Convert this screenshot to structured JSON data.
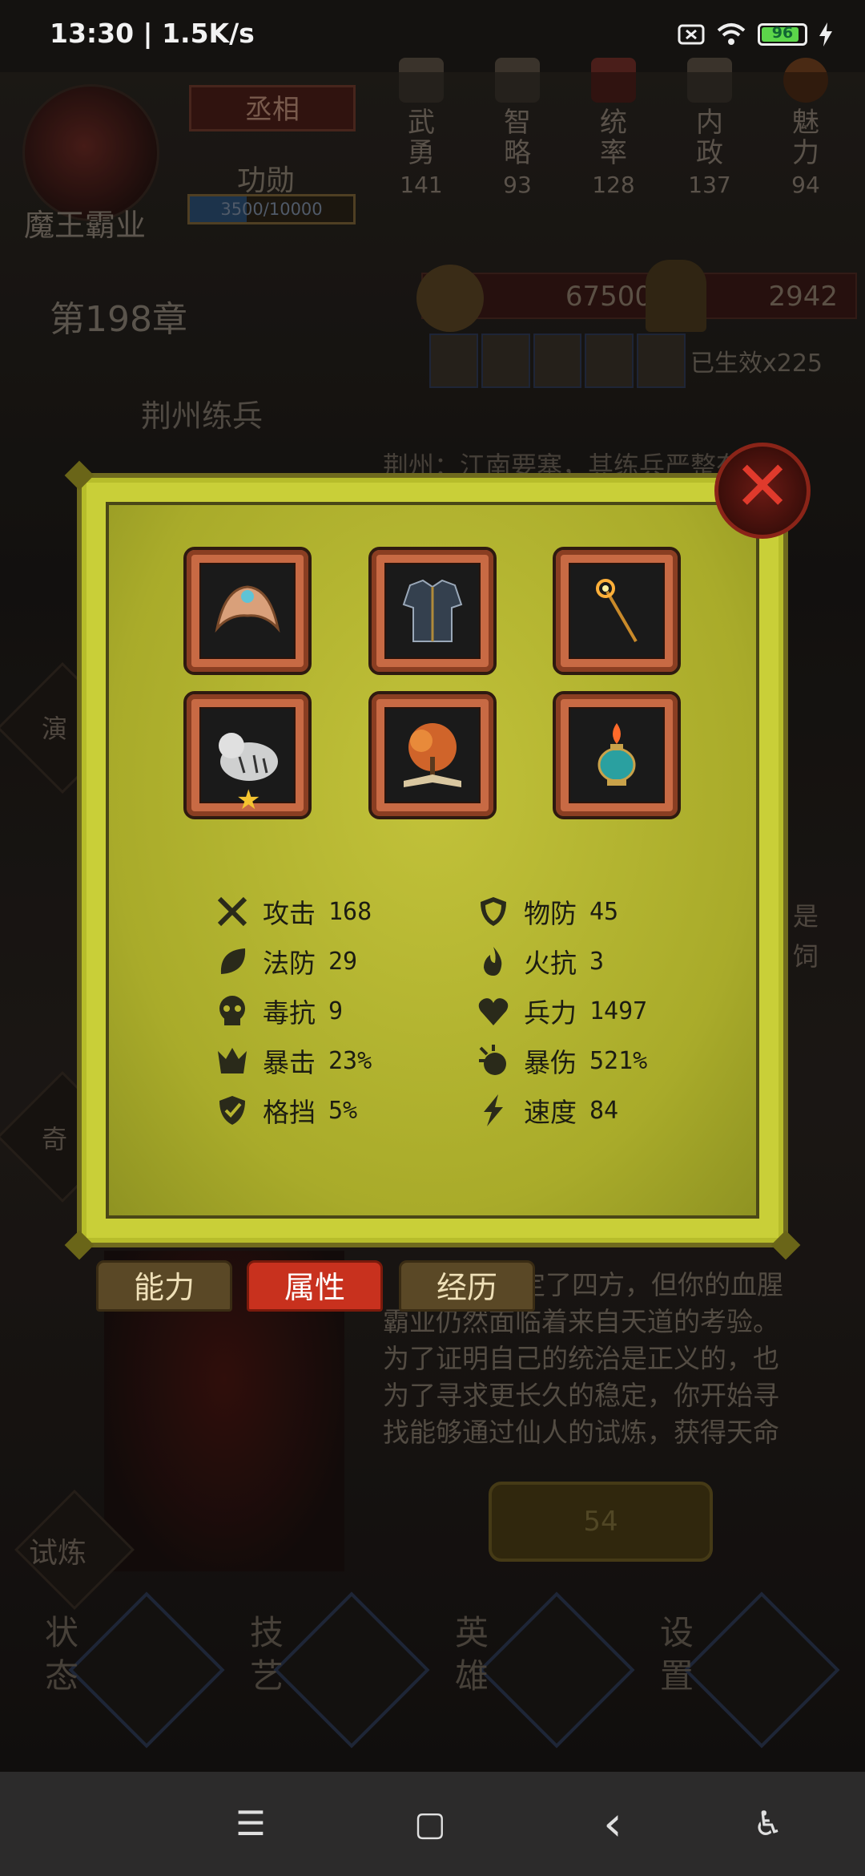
{
  "status_bar": {
    "time_speed": "13:30 | 1.5K/s",
    "battery": "96"
  },
  "header": {
    "title_badge": "丞相",
    "gongxun_label": "功勋",
    "exp_text": "3500/10000",
    "exp_progress": 0.35,
    "hero_name": "魔王霸业",
    "stats": [
      {
        "name": "武勇",
        "value": "141"
      },
      {
        "name": "智略",
        "value": "93"
      },
      {
        "name": "统率",
        "value": "128"
      },
      {
        "name": "内政",
        "value": "137"
      },
      {
        "name": "魅力",
        "value": "94"
      }
    ],
    "chapter": "第198章",
    "coins": "67500",
    "grain": "2942",
    "buildings_effect": "已生效x225",
    "mission": "荆州练兵"
  },
  "story": {
    "top_line": "荆州：江南要塞，其练兵严整有序。",
    "lower_lines": [
      "定了四方，但你的血腥",
      "霸业仍然面临着来自天道的考验。",
      "为了证明自己的统治是正义的，也",
      "为了寻求更长久的稳定，你开始寻",
      "找能够通过仙人的试炼，获得天命"
    ]
  },
  "side": {
    "left_top": "演",
    "left_mid": "奇",
    "trial": "试炼",
    "right_chars": [
      "是",
      "饲"
    ]
  },
  "action_button": {
    "value": "54"
  },
  "bottom_menu": [
    {
      "label_1": "状",
      "label_2": "态"
    },
    {
      "label_1": "技",
      "label_2": "艺"
    },
    {
      "label_1": "英",
      "label_2": "雄"
    },
    {
      "label_1": "设",
      "label_2": "置"
    }
  ],
  "modal": {
    "close_symbol": "✕",
    "equipment": [
      {
        "name": "crown-icon",
        "color": "#e0a070"
      },
      {
        "name": "armor-icon",
        "color": "#3c4a5c"
      },
      {
        "name": "staff-icon",
        "color": "#d08a2a"
      },
      {
        "name": "tiger-icon",
        "color": "#c8c8c8",
        "star": "★"
      },
      {
        "name": "tree-book-icon",
        "color": "#d0642a"
      },
      {
        "name": "lamp-icon",
        "color": "#2aa0a0"
      }
    ],
    "attributes_left": [
      {
        "icon": "sword-icon",
        "name": "攻击",
        "value": "168"
      },
      {
        "icon": "leaf-icon",
        "name": "法防",
        "value": "29"
      },
      {
        "icon": "skull-icon",
        "name": "毒抗",
        "value": "9"
      },
      {
        "icon": "crown-burst-icon",
        "name": "暴击",
        "value": "23%"
      },
      {
        "icon": "shield-check-icon",
        "name": "格挡",
        "value": "5%"
      }
    ],
    "attributes_right": [
      {
        "icon": "shield-icon",
        "name": "物防",
        "value": "45"
      },
      {
        "icon": "fire-icon",
        "name": "火抗",
        "value": "3"
      },
      {
        "icon": "heart-icon",
        "name": "兵力",
        "value": "1497"
      },
      {
        "icon": "explosion-icon",
        "name": "暴伤",
        "value": "521%"
      },
      {
        "icon": "lightning-icon",
        "name": "速度",
        "value": "84"
      }
    ],
    "tabs": [
      {
        "label": "能力",
        "active": false
      },
      {
        "label": "属性",
        "active": true
      },
      {
        "label": "经历",
        "active": false
      }
    ]
  },
  "nav_bar": {
    "menu": "☰",
    "home": "▢",
    "back": "‹",
    "accessibility": "♿"
  }
}
